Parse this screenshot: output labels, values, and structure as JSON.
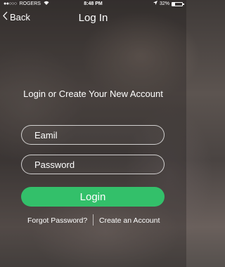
{
  "status_bar": {
    "carrier_dots": "●●○○○",
    "carrier": "ROGERS",
    "time": "8:48 PM",
    "battery_text": "32%",
    "battery_level": 0.32,
    "icons": [
      "signal-dots-icon",
      "wifi-icon",
      "location-arrow-icon",
      "battery-icon"
    ]
  },
  "nav": {
    "back_label": "Back",
    "title": "Log In",
    "back_icon": "chevron-left-icon"
  },
  "form": {
    "heading": "Login or Create Your New Account",
    "email_placeholder": "Eamil",
    "email_value": "",
    "password_placeholder": "Password",
    "password_value": "",
    "login_label": "Login"
  },
  "links": {
    "forgot_password": "Forgot Password?",
    "create_account": "Create an Account"
  },
  "colors": {
    "accent_green": "#33c06a",
    "text": "#ffffff"
  }
}
